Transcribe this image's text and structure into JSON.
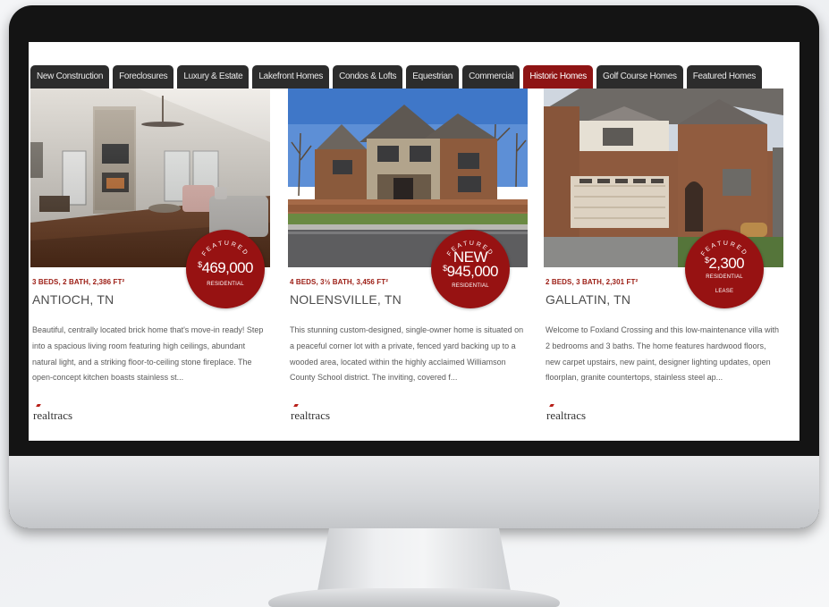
{
  "tabs": [
    {
      "label": "New Construction",
      "active": false
    },
    {
      "label": "Foreclosures",
      "active": false
    },
    {
      "label": "Luxury & Estate",
      "active": false
    },
    {
      "label": "Lakefront Homes",
      "active": false
    },
    {
      "label": "Condos & Lofts",
      "active": false
    },
    {
      "label": "Equestrian",
      "active": false
    },
    {
      "label": "Commercial",
      "active": false
    },
    {
      "label": "Historic Homes",
      "active": true
    },
    {
      "label": "Golf Course Homes",
      "active": false
    },
    {
      "label": "Featured Homes",
      "active": false
    }
  ],
  "listings": [
    {
      "badge_arc": "FEATURED",
      "badge_new": "",
      "price": "469,000",
      "currency": "$",
      "property_type": "RESIDENTIAL",
      "listing_type": "",
      "specs": "3 BEDS, 2 BATH, 2,386 FT²",
      "city": "ANTIOCH, TN",
      "description": "Beautiful, centrally located brick home that's move-in ready! Step into a spacious living room featuring high ceilings, abundant natural light, and a striking floor-to-ceiling stone fireplace. The open-concept kitchen boasts stainless st...",
      "logo": "realtracs"
    },
    {
      "badge_arc": "FEATURED",
      "badge_new": "NEW",
      "price": "945,000",
      "currency": "$",
      "property_type": "RESIDENTIAL",
      "listing_type": "",
      "specs": "4 BEDS, 3½ BATH, 3,456 FT²",
      "city": "NOLENSVILLE, TN",
      "description": "This stunning custom-designed, single-owner home is situated on a peaceful corner lot with a private, fenced yard backing up to a wooded area, located within the highly acclaimed Williamson County School district. The inviting, covered f...",
      "logo": "realtracs"
    },
    {
      "badge_arc": "FEATURED",
      "badge_new": "",
      "price": "2,300",
      "currency": "$",
      "property_type": "RESIDENTIAL",
      "listing_type": "LEASE",
      "specs": "2 BEDS, 3 BATH, 2,301 FT²",
      "city": "GALLATIN, TN",
      "description": "Welcome to Foxland Crossing and this low-maintenance villa with 2 bedrooms and 3 baths. The home features hardwood floors, new carpet upstairs, new paint, designer lighting updates, open floorplan, granite countertops, stainless steel ap...",
      "logo": "realtracs"
    }
  ],
  "colors": {
    "accent": "#971212",
    "tab_bg": "#2c2c2c",
    "tab_active": "#8e1414",
    "specs_text": "#9b1b12"
  },
  "icons": {
    "logo_mark": "realtracs-logo"
  }
}
